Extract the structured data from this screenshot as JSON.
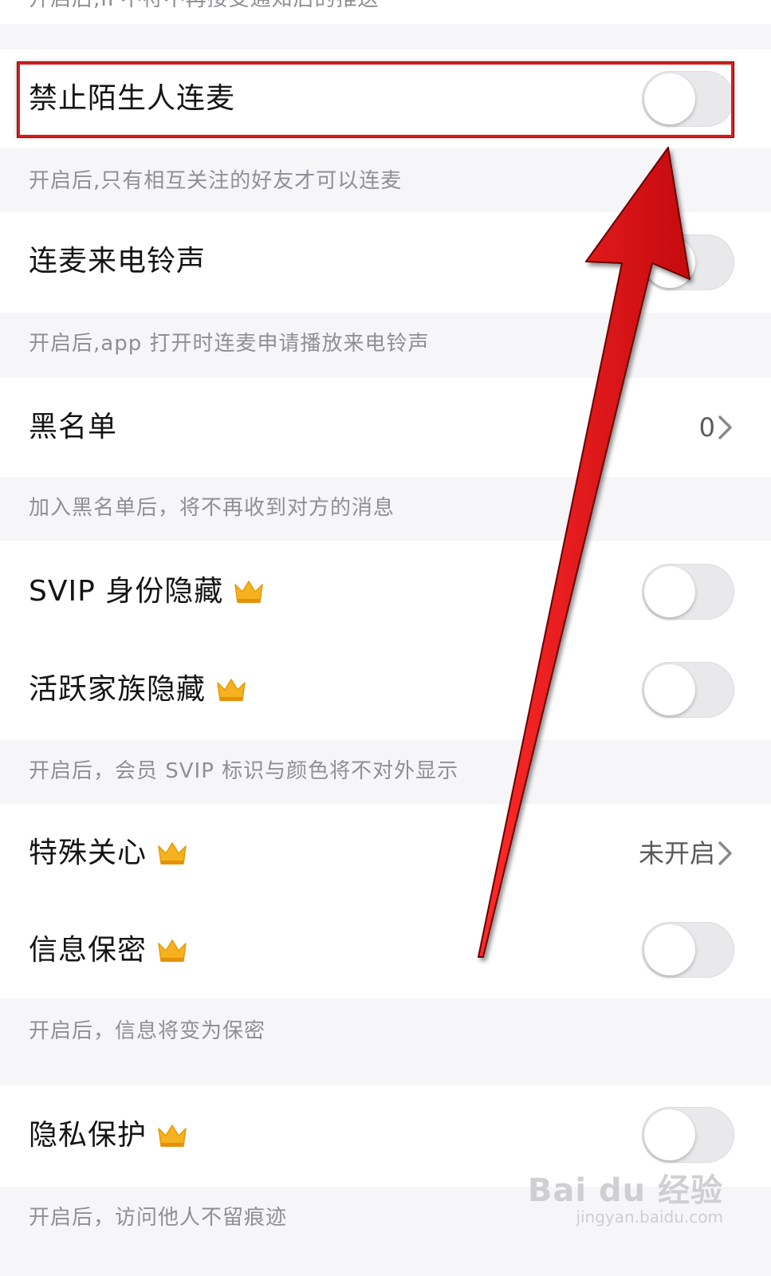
{
  "top_clipped_text": "开启后,IP不符不再接受通知后的推送",
  "items": {
    "stranger_mic": {
      "label": "禁止陌生人连麦",
      "on": false,
      "desc": "开启后,只有相互关注的好友才可以连麦"
    },
    "mic_ringtone": {
      "label": "连麦来电铃声",
      "on": false,
      "desc": "开启后,app 打开时连麦申请播放来电铃声"
    },
    "blacklist": {
      "label": "黑名单",
      "value": "0",
      "desc": "加入黑名单后，将不再收到对方的消息"
    },
    "svip_hide": {
      "label": "SVIP 身份隐藏",
      "on": false
    },
    "family_hide": {
      "label": "活跃家族隐藏",
      "on": false,
      "desc": "开启后，会员 SVIP 标识与颜色将不对外显示"
    },
    "special_care": {
      "label": "特殊关心",
      "value": "未开启"
    },
    "info_secret": {
      "label": "信息保密",
      "on": false,
      "desc": "开启后，信息将变为保密"
    },
    "privacy": {
      "label": "隐私保护",
      "on": false,
      "desc": "开启后，访问他人不留痕迹"
    }
  },
  "watermark": {
    "brand": "Bai du 经验",
    "url": "jingyan.baidu.com"
  },
  "colors": {
    "highlight": "#d61f1f",
    "arrow": "#e8141a",
    "crown": "#f5b21e"
  }
}
